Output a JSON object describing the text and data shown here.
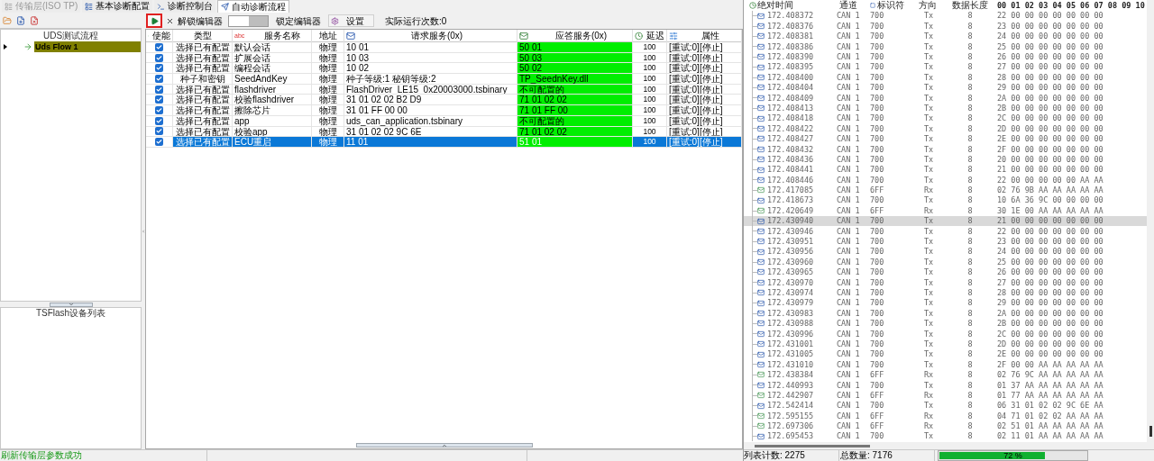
{
  "tabs": [
    {
      "label": "传输层(ISO TP)",
      "selected": false,
      "disabled": true
    },
    {
      "label": "基本诊断配置",
      "selected": false,
      "disabled": false
    },
    {
      "label": "诊断控制台",
      "selected": false,
      "disabled": false
    },
    {
      "label": "自动诊断流程",
      "selected": true,
      "disabled": false
    }
  ],
  "tree": {
    "header": "UDS测试流程",
    "items": [
      {
        "label": "Uds Flow 1",
        "selected": true
      }
    ]
  },
  "device_list": {
    "title": "TSFlash设备列表"
  },
  "toolbar": {
    "unlock": "解锁编辑器",
    "switch": {
      "on": false
    },
    "lock": "锁定编辑器",
    "settings": "设置",
    "run_count": "实际运行次数:0"
  },
  "table": {
    "columns": [
      {
        "label": "使能"
      },
      {
        "label": "类型"
      },
      {
        "label": "服务名称",
        "icon_text": "abc"
      },
      {
        "label": "地址"
      },
      {
        "label": "请求服务(0x)"
      },
      {
        "label": "应答服务(0x)"
      },
      {
        "label": "延迟"
      },
      {
        "label": "属性"
      }
    ],
    "rows": [
      {
        "enabled": true,
        "selected": false,
        "type": "选择已有配置",
        "name": "默认会话",
        "address": "物理",
        "request": "10 01",
        "response": "50 01",
        "delay": "100",
        "attr": "[重试:0][停止]"
      },
      {
        "enabled": true,
        "selected": false,
        "type": "选择已有配置",
        "name": "扩展会话",
        "address": "物理",
        "request": "10 03",
        "response": "50 03",
        "delay": "100",
        "attr": "[重试:0][停止]"
      },
      {
        "enabled": true,
        "selected": false,
        "type": "选择已有配置",
        "name": "编程会话",
        "address": "物理",
        "request": "10 02",
        "response": "50 02",
        "delay": "100",
        "attr": "[重试:0][停止]"
      },
      {
        "enabled": true,
        "selected": false,
        "type": "种子和密钥",
        "name": "SeedAndKey",
        "address": "物理",
        "request": "种子等级:1 秘钥等级:2",
        "response": "TP_SeednKey.dll",
        "delay": "100",
        "attr": "[重试:0][停止]"
      },
      {
        "enabled": true,
        "selected": false,
        "type": "选择已有配置",
        "name": "flashdriver",
        "address": "物理",
        "request": "FlashDriver_LE15_0x20003000.tsbinary",
        "response": "不可配置的",
        "delay": "100",
        "attr": "[重试:0][停止]"
      },
      {
        "enabled": true,
        "selected": false,
        "type": "选择已有配置",
        "name": "校验flashdriver",
        "address": "物理",
        "request": "31 01 02 02 B2 D9",
        "response": "71 01 02 02",
        "delay": "100",
        "attr": "[重试:0][停止]"
      },
      {
        "enabled": true,
        "selected": false,
        "type": "选择已有配置",
        "name": "擦除芯片",
        "address": "物理",
        "request": "31 01 FF 00 00",
        "response": "71 01 FF 00",
        "delay": "100",
        "attr": "[重试:0][停止]"
      },
      {
        "enabled": true,
        "selected": false,
        "type": "选择已有配置",
        "name": "app",
        "address": "物理",
        "request": "uds_can_application.tsbinary",
        "response": "不可配置的",
        "delay": "100",
        "attr": "[重试:0][停止]"
      },
      {
        "enabled": true,
        "selected": false,
        "type": "选择已有配置",
        "name": "校验app",
        "address": "物理",
        "request": "31 01 02 02 9C 6E",
        "response": "71 01 02 02",
        "delay": "100",
        "attr": "[重试:0][停止]"
      },
      {
        "enabled": true,
        "selected": true,
        "type": "选择已有配置",
        "name": "ECU重启",
        "address": "物理",
        "request": "11 01",
        "response": "51 01",
        "delay": "100",
        "attr": "[重试:0][停止]"
      }
    ]
  },
  "status_bar": {
    "message": "刷新传输层参数成功"
  },
  "log": {
    "columns": [
      "绝对时间",
      "通道",
      "标识符",
      "方向",
      "数据长度",
      "00 01 02 03 04 05 06 07 08 09 10"
    ],
    "rows": [
      {
        "kind": "tx",
        "selected": false,
        "time": "172.408372",
        "channel": "CAN 1",
        "id": "700",
        "dir": "Tx",
        "dlc": "8",
        "data": "22 00 00 00 00 00 00 00"
      },
      {
        "kind": "tx",
        "selected": false,
        "time": "172.408376",
        "channel": "CAN 1",
        "id": "700",
        "dir": "Tx",
        "dlc": "8",
        "data": "23 00 00 00 00 00 00 00"
      },
      {
        "kind": "tx",
        "selected": false,
        "time": "172.408381",
        "channel": "CAN 1",
        "id": "700",
        "dir": "Tx",
        "dlc": "8",
        "data": "24 00 00 00 00 00 00 00"
      },
      {
        "kind": "tx",
        "selected": false,
        "time": "172.408386",
        "channel": "CAN 1",
        "id": "700",
        "dir": "Tx",
        "dlc": "8",
        "data": "25 00 00 00 00 00 00 00"
      },
      {
        "kind": "tx",
        "selected": false,
        "time": "172.408390",
        "channel": "CAN 1",
        "id": "700",
        "dir": "Tx",
        "dlc": "8",
        "data": "26 00 00 00 00 00 00 00"
      },
      {
        "kind": "tx",
        "selected": false,
        "time": "172.408395",
        "channel": "CAN 1",
        "id": "700",
        "dir": "Tx",
        "dlc": "8",
        "data": "27 00 00 00 00 00 00 00"
      },
      {
        "kind": "tx",
        "selected": false,
        "time": "172.408400",
        "channel": "CAN 1",
        "id": "700",
        "dir": "Tx",
        "dlc": "8",
        "data": "28 00 00 00 00 00 00 00"
      },
      {
        "kind": "tx",
        "selected": false,
        "time": "172.408404",
        "channel": "CAN 1",
        "id": "700",
        "dir": "Tx",
        "dlc": "8",
        "data": "29 00 00 00 00 00 00 00"
      },
      {
        "kind": "tx",
        "selected": false,
        "time": "172.408409",
        "channel": "CAN 1",
        "id": "700",
        "dir": "Tx",
        "dlc": "8",
        "data": "2A 00 00 00 00 00 00 00"
      },
      {
        "kind": "tx",
        "selected": false,
        "time": "172.408413",
        "channel": "CAN 1",
        "id": "700",
        "dir": "Tx",
        "dlc": "8",
        "data": "2B 00 00 00 00 00 00 00"
      },
      {
        "kind": "tx",
        "selected": false,
        "time": "172.408418",
        "channel": "CAN 1",
        "id": "700",
        "dir": "Tx",
        "dlc": "8",
        "data": "2C 00 00 00 00 00 00 00"
      },
      {
        "kind": "tx",
        "selected": false,
        "time": "172.408422",
        "channel": "CAN 1",
        "id": "700",
        "dir": "Tx",
        "dlc": "8",
        "data": "2D 00 00 00 00 00 00 00"
      },
      {
        "kind": "tx",
        "selected": false,
        "time": "172.408427",
        "channel": "CAN 1",
        "id": "700",
        "dir": "Tx",
        "dlc": "8",
        "data": "2E 00 00 00 00 00 00 00"
      },
      {
        "kind": "tx",
        "selected": false,
        "time": "172.408432",
        "channel": "CAN 1",
        "id": "700",
        "dir": "Tx",
        "dlc": "8",
        "data": "2F 00 00 00 00 00 00 00"
      },
      {
        "kind": "tx",
        "selected": false,
        "time": "172.408436",
        "channel": "CAN 1",
        "id": "700",
        "dir": "Tx",
        "dlc": "8",
        "data": "20 00 00 00 00 00 00 00"
      },
      {
        "kind": "tx",
        "selected": false,
        "time": "172.408441",
        "channel": "CAN 1",
        "id": "700",
        "dir": "Tx",
        "dlc": "8",
        "data": "21 00 00 00 00 00 00 00"
      },
      {
        "kind": "tx",
        "selected": false,
        "time": "172.408446",
        "channel": "CAN 1",
        "id": "700",
        "dir": "Tx",
        "dlc": "8",
        "data": "22 00 00 00 00 00 AA AA"
      },
      {
        "kind": "rx",
        "selected": false,
        "time": "172.417085",
        "channel": "CAN 1",
        "id": "6FF",
        "dir": "Rx",
        "dlc": "8",
        "data": "02 76 9B AA AA AA AA AA"
      },
      {
        "kind": "tx",
        "selected": false,
        "time": "172.418673",
        "channel": "CAN 1",
        "id": "700",
        "dir": "Tx",
        "dlc": "8",
        "data": "10 6A 36 9C 00 00 00 00"
      },
      {
        "kind": "rx",
        "selected": false,
        "time": "172.420649",
        "channel": "CAN 1",
        "id": "6FF",
        "dir": "Rx",
        "dlc": "8",
        "data": "30 1E 00 AA AA AA AA AA"
      },
      {
        "kind": "tx",
        "selected": true,
        "time": "172.430940",
        "channel": "CAN 1",
        "id": "700",
        "dir": "Tx",
        "dlc": "8",
        "data": "21 00 00 00 00 00 00 00"
      },
      {
        "kind": "tx",
        "selected": false,
        "time": "172.430946",
        "channel": "CAN 1",
        "id": "700",
        "dir": "Tx",
        "dlc": "8",
        "data": "22 00 00 00 00 00 00 00"
      },
      {
        "kind": "tx",
        "selected": false,
        "time": "172.430951",
        "channel": "CAN 1",
        "id": "700",
        "dir": "Tx",
        "dlc": "8",
        "data": "23 00 00 00 00 00 00 00"
      },
      {
        "kind": "tx",
        "selected": false,
        "time": "172.430956",
        "channel": "CAN 1",
        "id": "700",
        "dir": "Tx",
        "dlc": "8",
        "data": "24 00 00 00 00 00 00 00"
      },
      {
        "kind": "tx",
        "selected": false,
        "time": "172.430960",
        "channel": "CAN 1",
        "id": "700",
        "dir": "Tx",
        "dlc": "8",
        "data": "25 00 00 00 00 00 00 00"
      },
      {
        "kind": "tx",
        "selected": false,
        "time": "172.430965",
        "channel": "CAN 1",
        "id": "700",
        "dir": "Tx",
        "dlc": "8",
        "data": "26 00 00 00 00 00 00 00"
      },
      {
        "kind": "tx",
        "selected": false,
        "time": "172.430970",
        "channel": "CAN 1",
        "id": "700",
        "dir": "Tx",
        "dlc": "8",
        "data": "27 00 00 00 00 00 00 00"
      },
      {
        "kind": "tx",
        "selected": false,
        "time": "172.430974",
        "channel": "CAN 1",
        "id": "700",
        "dir": "Tx",
        "dlc": "8",
        "data": "28 00 00 00 00 00 00 00"
      },
      {
        "kind": "tx",
        "selected": false,
        "time": "172.430979",
        "channel": "CAN 1",
        "id": "700",
        "dir": "Tx",
        "dlc": "8",
        "data": "29 00 00 00 00 00 00 00"
      },
      {
        "kind": "tx",
        "selected": false,
        "time": "172.430983",
        "channel": "CAN 1",
        "id": "700",
        "dir": "Tx",
        "dlc": "8",
        "data": "2A 00 00 00 00 00 00 00"
      },
      {
        "kind": "tx",
        "selected": false,
        "time": "172.430988",
        "channel": "CAN 1",
        "id": "700",
        "dir": "Tx",
        "dlc": "8",
        "data": "2B 00 00 00 00 00 00 00"
      },
      {
        "kind": "tx",
        "selected": false,
        "time": "172.430996",
        "channel": "CAN 1",
        "id": "700",
        "dir": "Tx",
        "dlc": "8",
        "data": "2C 00 00 00 00 00 00 00"
      },
      {
        "kind": "tx",
        "selected": false,
        "time": "172.431001",
        "channel": "CAN 1",
        "id": "700",
        "dir": "Tx",
        "dlc": "8",
        "data": "2D 00 00 00 00 00 00 00"
      },
      {
        "kind": "tx",
        "selected": false,
        "time": "172.431005",
        "channel": "CAN 1",
        "id": "700",
        "dir": "Tx",
        "dlc": "8",
        "data": "2E 00 00 00 00 00 00 00"
      },
      {
        "kind": "tx",
        "selected": false,
        "time": "172.431010",
        "channel": "CAN 1",
        "id": "700",
        "dir": "Tx",
        "dlc": "8",
        "data": "2F 00 00 AA AA AA AA AA"
      },
      {
        "kind": "rx",
        "selected": false,
        "time": "172.438384",
        "channel": "CAN 1",
        "id": "6FF",
        "dir": "Rx",
        "dlc": "8",
        "data": "02 76 9C AA AA AA AA AA"
      },
      {
        "kind": "tx",
        "selected": false,
        "time": "172.440993",
        "channel": "CAN 1",
        "id": "700",
        "dir": "Tx",
        "dlc": "8",
        "data": "01 37 AA AA AA AA AA AA"
      },
      {
        "kind": "rx",
        "selected": false,
        "time": "172.442907",
        "channel": "CAN 1",
        "id": "6FF",
        "dir": "Rx",
        "dlc": "8",
        "data": "01 77 AA AA AA AA AA AA"
      },
      {
        "kind": "tx",
        "selected": false,
        "time": "172.542414",
        "channel": "CAN 1",
        "id": "700",
        "dir": "Tx",
        "dlc": "8",
        "data": "06 31 01 02 02 9C 6E AA"
      },
      {
        "kind": "rx",
        "selected": false,
        "time": "172.595155",
        "channel": "CAN 1",
        "id": "6FF",
        "dir": "Rx",
        "dlc": "8",
        "data": "04 71 01 02 02 AA AA AA"
      },
      {
        "kind": "rx",
        "selected": false,
        "time": "172.697306",
        "channel": "CAN 1",
        "id": "6FF",
        "dir": "Rx",
        "dlc": "8",
        "data": "02 51 01 AA AA AA AA AA"
      },
      {
        "kind": "tx",
        "selected": false,
        "time": "172.695453",
        "channel": "CAN 1",
        "id": "700",
        "dir": "Tx",
        "dlc": "8",
        "data": "02 11 01 AA AA AA AA AA"
      }
    ],
    "footer": {
      "list_count": "列表计数: 2275",
      "total": "总数量: 7176",
      "progress": {
        "level": 0.72,
        "label": "72 %"
      }
    }
  }
}
